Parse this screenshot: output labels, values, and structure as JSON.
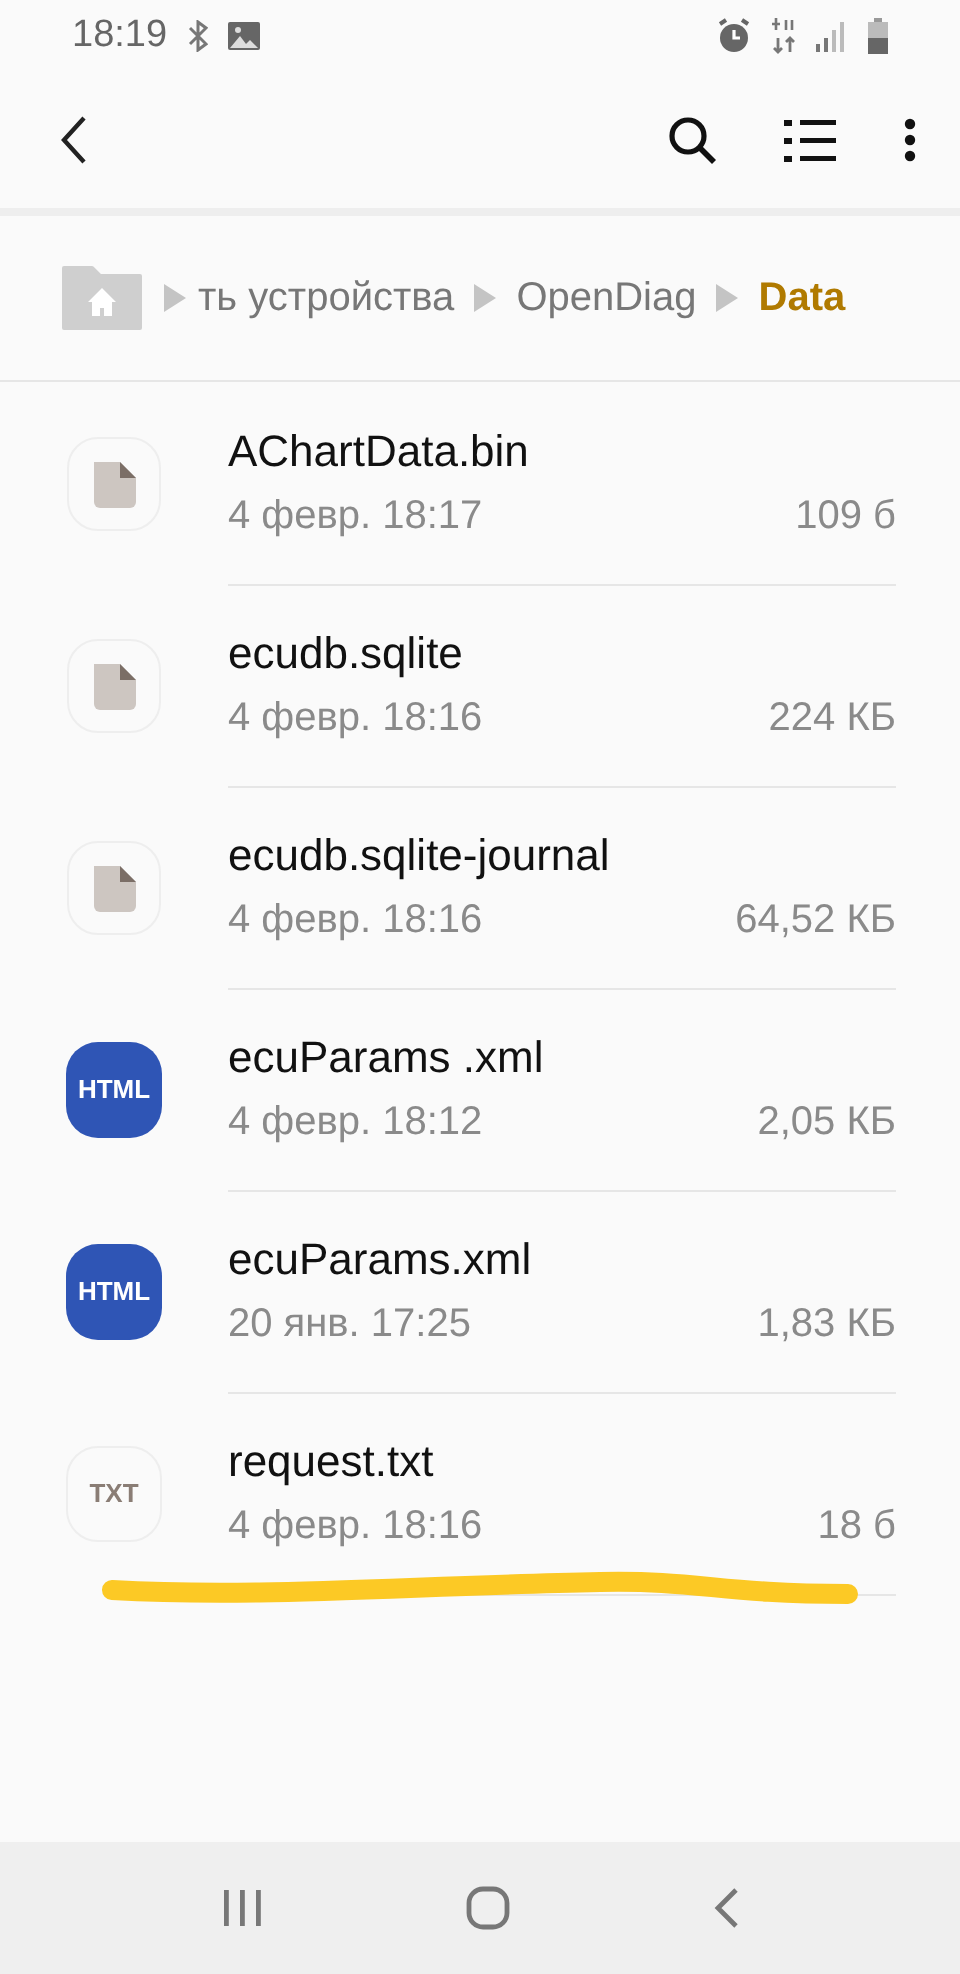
{
  "status_bar": {
    "time": "18:19"
  },
  "breadcrumb": {
    "items": [
      {
        "label": "ть устройства",
        "selected": false
      },
      {
        "label": "OpenDiag",
        "selected": false
      },
      {
        "label": "Data",
        "selected": true
      }
    ]
  },
  "files": [
    {
      "kind": "file",
      "name": "AChartData.bin",
      "date": "4 февр. 18:17",
      "size": "109 б"
    },
    {
      "kind": "file",
      "name": "ecudb.sqlite",
      "date": "4 февр. 18:16",
      "size": "224 КБ"
    },
    {
      "kind": "file",
      "name": "ecudb.sqlite-journal",
      "date": "4 февр. 18:16",
      "size": "64,52 КБ"
    },
    {
      "kind": "html",
      "badge": "HTML",
      "name": "ecuParams .xml",
      "date": "4 февр. 18:12",
      "size": "2,05 КБ"
    },
    {
      "kind": "html",
      "badge": "HTML",
      "name": "ecuParams.xml",
      "date": "20 янв. 17:25",
      "size": "1,83 КБ"
    },
    {
      "kind": "txt",
      "badge": "TXT",
      "name": "request.txt",
      "date": "4 февр. 18:16",
      "size": "18 б"
    }
  ]
}
